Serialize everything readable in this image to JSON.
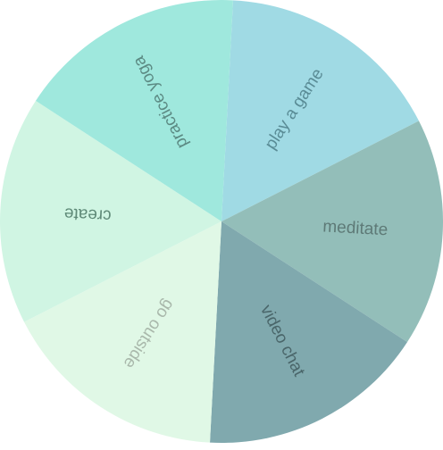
{
  "wheel": {
    "segments": [
      {
        "label": "play a game",
        "color": "#a0dae4",
        "text_color": "#5a8c96"
      },
      {
        "label": "meditate",
        "color": "#93beb9",
        "text_color": "#5e7a77"
      },
      {
        "label": "video chat",
        "color": "#80a9ae",
        "text_color": "#4a666a"
      },
      {
        "label": "go outside",
        "color": "#e0f8e6",
        "text_color": "#a9b8ab"
      },
      {
        "label": "create",
        "color": "#d0f5e3",
        "text_color": "#5f8a78"
      },
      {
        "label": "practice yoga",
        "color": "#9fe8dd",
        "text_color": "#5c8a83"
      }
    ]
  }
}
